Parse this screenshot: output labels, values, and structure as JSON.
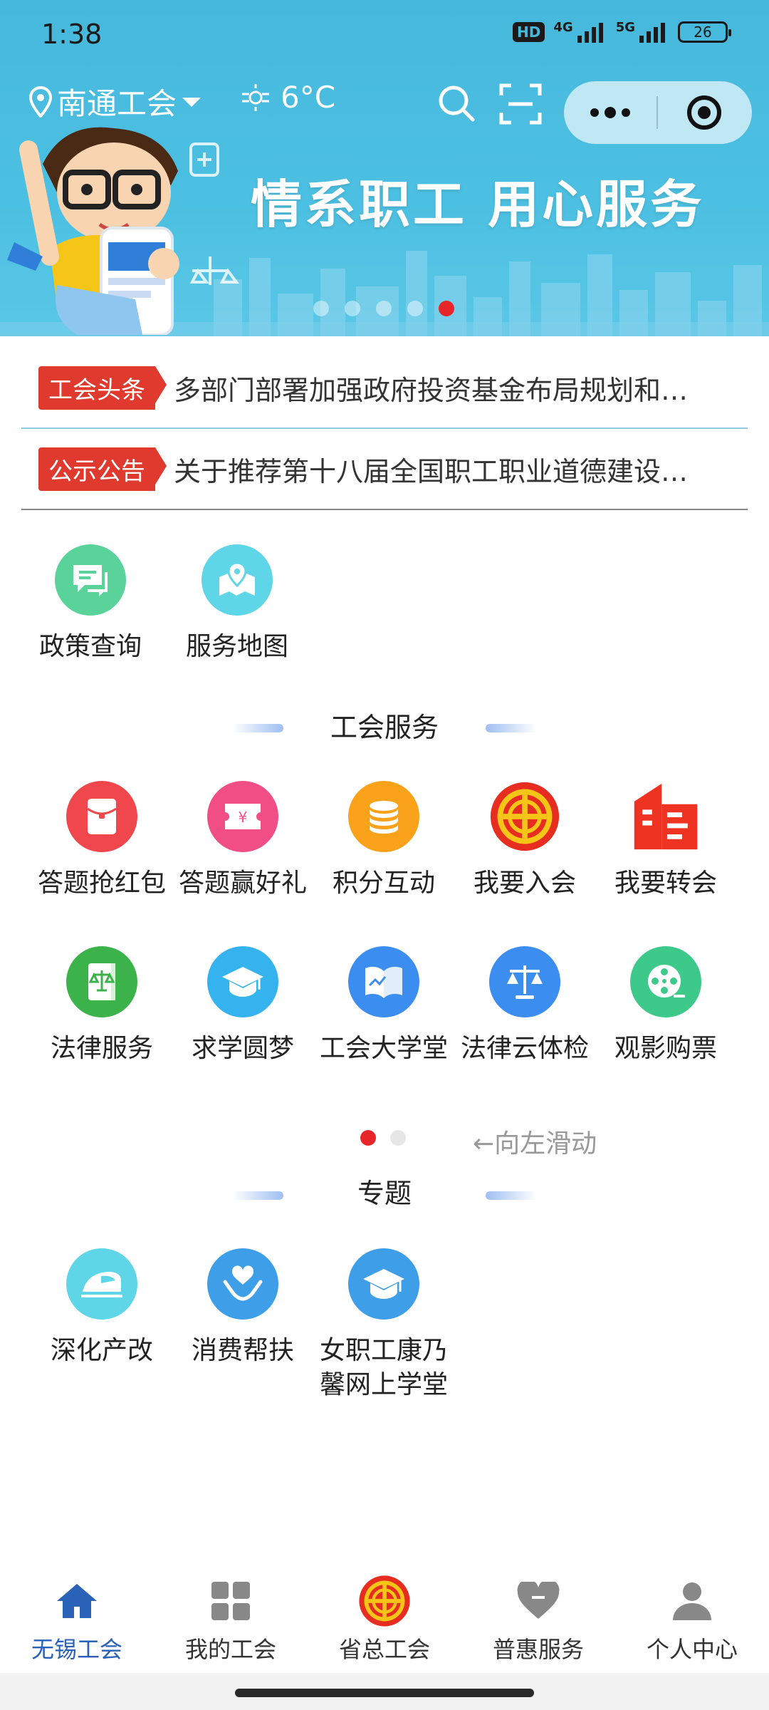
{
  "status_bar": {
    "time": "1:38",
    "hd": "HD",
    "net1": "4G",
    "net2": "5G",
    "battery": "26"
  },
  "header": {
    "location": "南通工会",
    "weather": "6°C",
    "slogan": "情系职工  用心服务"
  },
  "news": [
    {
      "tag": "工会头条",
      "text": "多部门部署加强政府投资基金布局规划和…"
    },
    {
      "tag": "公示公告",
      "text": "关于推荐第十八届全国职工职业道德建设…"
    }
  ],
  "quick_links": [
    {
      "label": "政策查询",
      "icon": "chat-icon",
      "color": "#5ad39a"
    },
    {
      "label": "服务地图",
      "icon": "map-pin-icon",
      "color": "#5fd5e8"
    }
  ],
  "union_services": {
    "title": "工会服务",
    "items": [
      {
        "label": "答题抢红包",
        "icon": "red-envelope-icon",
        "color": "#f0474c"
      },
      {
        "label": "答题赢好礼",
        "icon": "ticket-icon",
        "color": "#f24e86"
      },
      {
        "label": "积分互动",
        "icon": "coins-icon",
        "color": "#f9a21a"
      },
      {
        "label": "我要入会",
        "icon": "union-emblem-icon",
        "color": "#e62d20"
      },
      {
        "label": "我要转会",
        "icon": "building-icon",
        "color": "#ef3322"
      },
      {
        "label": "法律服务",
        "icon": "law-book-icon",
        "color": "#3cb24a"
      },
      {
        "label": "求学圆梦",
        "icon": "graduation-cap-icon",
        "color": "#35b3ee"
      },
      {
        "label": "工会大学堂",
        "icon": "open-book-icon",
        "color": "#3b8ef0"
      },
      {
        "label": "法律云体检",
        "icon": "scales-icon",
        "color": "#3b8ef0"
      },
      {
        "label": "观影购票",
        "icon": "film-reel-icon",
        "color": "#3cc98a"
      }
    ],
    "swipe_hint": "←向左滑动"
  },
  "topics": {
    "title": "专题",
    "items": [
      {
        "label": "深化产改",
        "icon": "train-icon",
        "color": "#5fd5e8"
      },
      {
        "label": "消费帮扶",
        "icon": "heart-hands-icon",
        "color": "#3e9ee8"
      },
      {
        "label_line1": "女职工康乃",
        "label_line2": "馨网上学堂",
        "icon": "graduation-cap-icon",
        "color": "#3e9ee8"
      }
    ]
  },
  "tabbar": [
    {
      "label": "无锡工会",
      "icon": "home-icon"
    },
    {
      "label": "我的工会",
      "icon": "grid-icon"
    },
    {
      "label": "省总工会",
      "icon": "union-emblem-icon"
    },
    {
      "label": "普惠服务",
      "icon": "heart-icon"
    },
    {
      "label": "个人中心",
      "icon": "person-icon"
    }
  ]
}
